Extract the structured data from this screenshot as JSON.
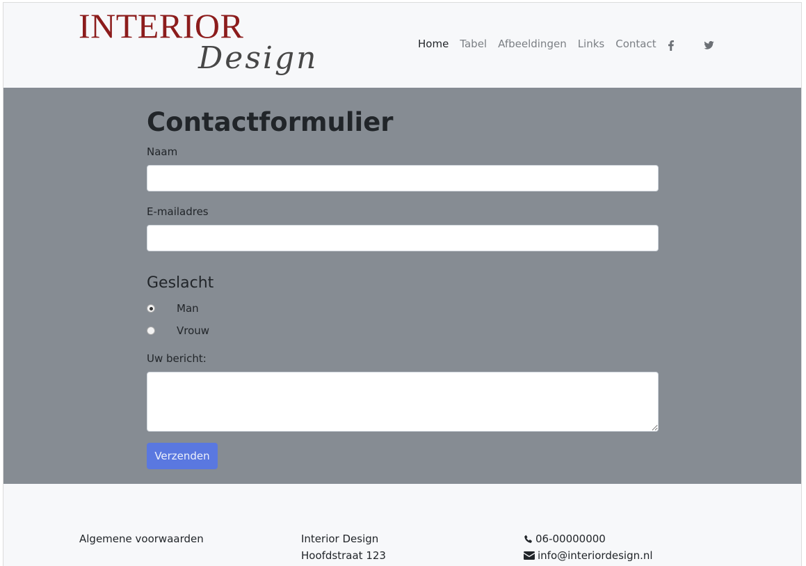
{
  "logo": {
    "line1": "INTERIOR",
    "line2": "Design"
  },
  "nav": {
    "items": [
      {
        "label": "Home"
      },
      {
        "label": "Tabel"
      },
      {
        "label": "Afbeeldingen"
      },
      {
        "label": "Links"
      },
      {
        "label": "Contact"
      }
    ],
    "social": [
      "facebook-icon",
      "twitter-icon"
    ]
  },
  "form": {
    "title": "Contactformulier",
    "name_label": "Naam",
    "name_value": "",
    "email_label": "E-mailadres",
    "email_value": "",
    "gender_heading": "Geslacht",
    "gender_options": [
      {
        "label": "Man",
        "checked": true
      },
      {
        "label": "Vrouw",
        "checked": false
      }
    ],
    "message_label": "Uw bericht:",
    "message_value": "",
    "submit_label": "Verzenden"
  },
  "footer": {
    "terms": "Algemene voorwaarden",
    "company": "Interior Design",
    "address": "Hoofdstraat 123",
    "phone": "06-00000000",
    "email": "info@interiordesign.nl"
  },
  "colors": {
    "logo_red": "#8c1c1c",
    "main_bg": "#868c93",
    "button": "#5a78e0",
    "header_bg": "#f7f8fa"
  }
}
